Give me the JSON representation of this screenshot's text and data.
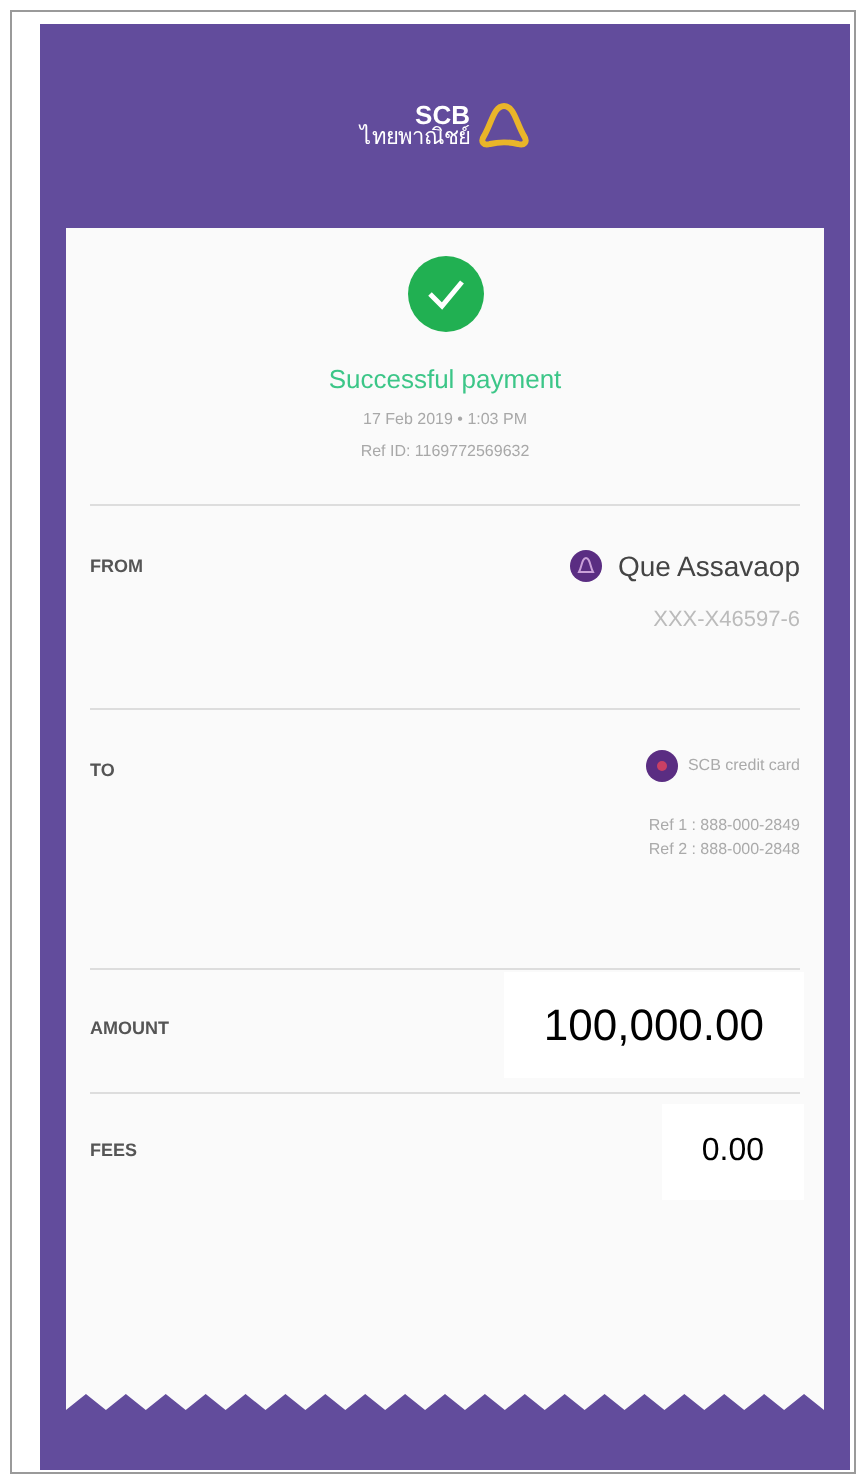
{
  "header": {
    "logo_text": "SCB",
    "logo_subtext": "ไทยพาณิชย์"
  },
  "status": {
    "title": "Successful payment",
    "datetime": "17 Feb 2019 • 1:03 PM",
    "ref_id": "Ref ID: 1169772569632"
  },
  "from": {
    "label": "FROM",
    "name": "Que Assavaop",
    "account": "XXX-X46597-6"
  },
  "to": {
    "label": "TO",
    "name": "SCB credit card",
    "refs": [
      "Ref 1 : 888-000-2849",
      "Ref 2 : 888-000-2848"
    ]
  },
  "amount": {
    "label": "AMOUNT",
    "value": "100,000.00"
  },
  "fees": {
    "label": "FEES",
    "value": "0.00"
  }
}
